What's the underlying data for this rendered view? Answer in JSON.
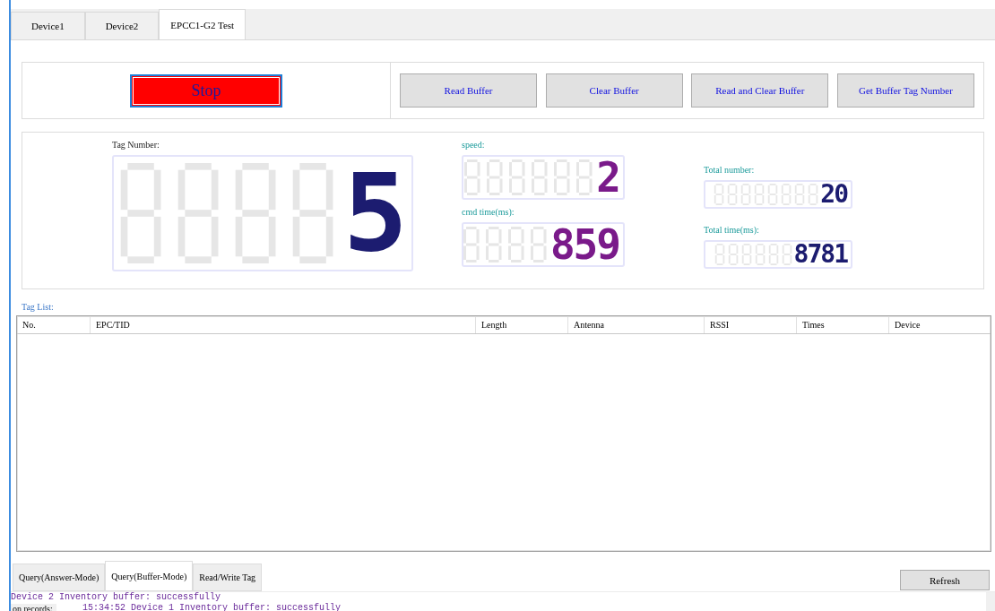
{
  "tabs": [
    {
      "label": "Device1",
      "selected": false
    },
    {
      "label": "Device2",
      "selected": false
    },
    {
      "label": "EPCC1-G2 Test",
      "selected": true
    }
  ],
  "controls": {
    "stop_button": "Stop",
    "buttons": [
      "Read Buffer",
      "Clear Buffer",
      "Read and Clear Buffer",
      "Get Buffer Tag Number"
    ]
  },
  "displays": {
    "tag_number": {
      "label": "Tag Number:",
      "value": "5"
    },
    "speed": {
      "label": "speed:",
      "value": "2"
    },
    "cmd_time": {
      "label": "cmd time(ms):",
      "value": "859"
    },
    "total_number": {
      "label": "Total number:",
      "value": "20"
    },
    "total_time": {
      "label": "Total time(ms):",
      "value": "8781"
    }
  },
  "tag_list": {
    "label": "Tag List:",
    "columns": [
      "No.",
      "EPC/TID",
      "Length",
      "Antenna",
      "RSSI",
      "Times",
      "Device"
    ]
  },
  "bottom_tabs": [
    {
      "label": "Query(Answer-Mode)",
      "selected": false
    },
    {
      "label": "Query(Buffer-Mode)",
      "selected": true
    },
    {
      "label": "Read/Write Tag",
      "selected": false
    }
  ],
  "refresh_button": "Refresh",
  "log": {
    "label": "on records:",
    "lines": [
      "Device 2 Inventory buffer: successfully",
      "15:34:52 Device 1 Inventory buffer: successfully"
    ]
  }
}
